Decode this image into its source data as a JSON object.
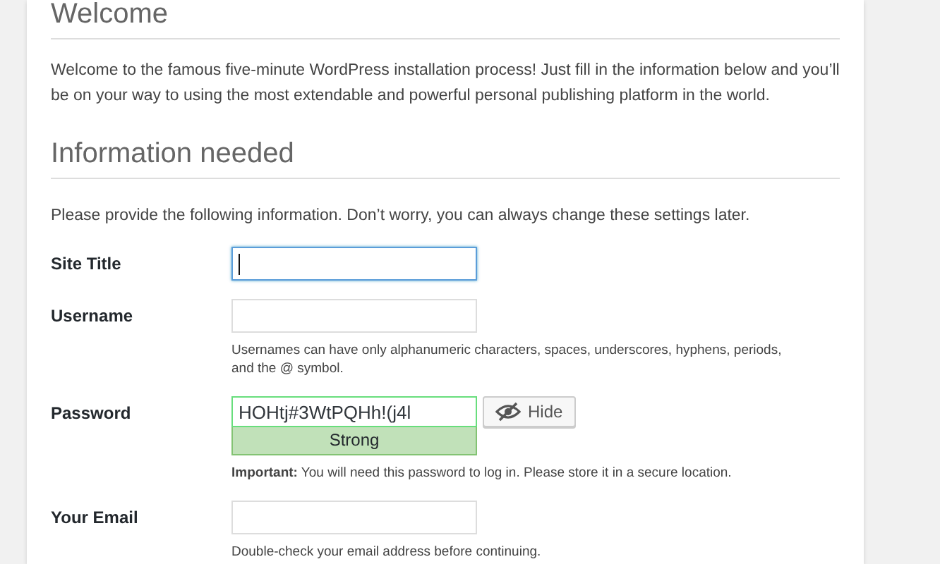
{
  "headings": [
    "Welcome",
    "Information needed"
  ],
  "intro": "Welcome to the famous five-minute WordPress installation process! Just fill in the information below and you’ll be on your way to using the most extendable and powerful personal publishing platform in the world.",
  "instructions": "Please provide the following information. Don’t worry, you can always change these settings later.",
  "fields": [
    {
      "label": "Site Title",
      "kind": "text",
      "focused": true
    },
    {
      "label": "Username",
      "kind": "text",
      "focused": false,
      "hint": "Usernames can have only alphanumeric characters, spaces, underscores, hyphens, periods, and the @ symbol."
    },
    {
      "label": "Password",
      "kind": "password",
      "focused": false,
      "value": "HOHtj#3WtPQHh!(j4l",
      "strength": "Strong",
      "toggle": "Hide",
      "hint": "**Important:** You will need this password to log in. Please store it in a secure location."
    },
    {
      "label": "Your Email",
      "kind": "text",
      "focused": false,
      "hint": "Double-check your email address before continuing."
    }
  ]
}
